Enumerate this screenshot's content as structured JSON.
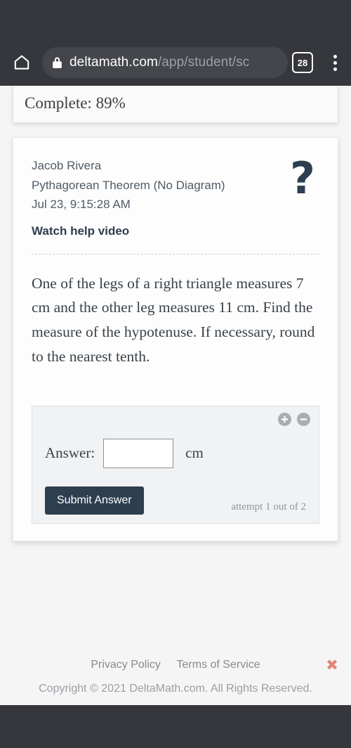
{
  "browser": {
    "home_icon": "home-icon",
    "lock_icon": "lock-icon",
    "url_host": "deltamath.com",
    "url_path": "/app/student/sc",
    "tab_count": "28",
    "menu_icon": "overflow-menu-icon"
  },
  "progress": {
    "label": "Complete: 89%"
  },
  "problem": {
    "student_name": "Jacob Rivera",
    "assignment_title": "Pythagorean Theorem (No Diagram)",
    "timestamp": "Jul 23, 9:15:28 AM",
    "help_video_label": "Watch help video",
    "help_icon": "question-mark-icon",
    "question_text": "One of the legs of a right triangle measures 7 cm and the other leg measures 11 cm. Find the measure of the hypotenuse. If necessary, round to the nearest tenth."
  },
  "answer_panel": {
    "zoom_in_icon": "plus-circle-icon",
    "zoom_out_icon": "minus-circle-icon",
    "answer_label": "Answer:",
    "answer_value": "",
    "answer_placeholder": "",
    "unit_label": "cm",
    "submit_label": "Submit Answer",
    "attempt_text": "attempt 1 out of 2"
  },
  "footer": {
    "privacy_label": "Privacy Policy",
    "terms_label": "Terms of Service",
    "copyright": "Copyright © 2021 DeltaMath.com. All Rights Reserved.",
    "close_icon": "close-x-icon",
    "close_glyph": "✖"
  },
  "colors": {
    "chrome_bg": "#35373d",
    "accent_navy": "#2c3e50",
    "close_red": "#e08678"
  }
}
